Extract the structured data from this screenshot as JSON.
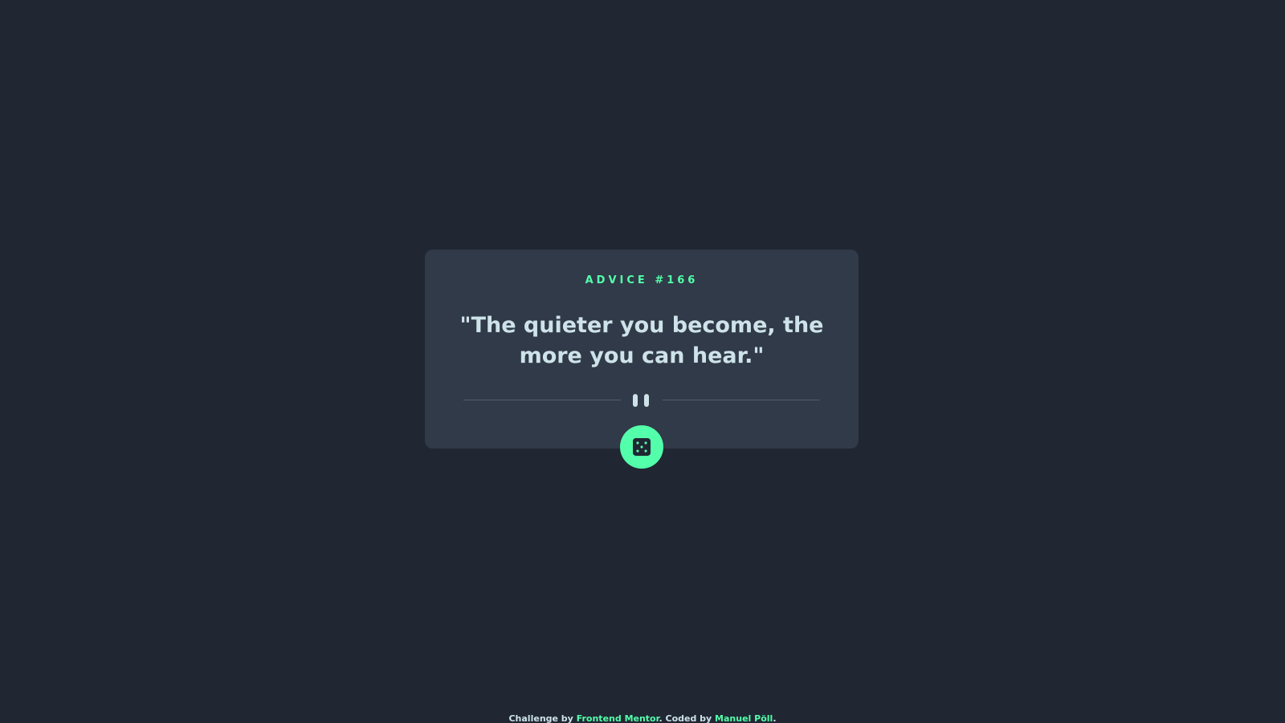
{
  "card": {
    "advice_label": "ADVICE #166",
    "quote": "\"The quieter you become, the more you can hear.\""
  },
  "dice_button": {
    "icon": "dice-icon"
  },
  "divider": {
    "icon": "pause-icon"
  },
  "footer": {
    "prefix": "Challenge by ",
    "challenge_link": "Frontend Mentor",
    "middle": ". Coded by ",
    "author_link": "Manuel Pöll",
    "suffix": "."
  },
  "colors": {
    "background": "#202733",
    "card": "#313a48",
    "accent": "#53ffaa",
    "text": "#cee3e9",
    "divider": "#4f5d74"
  }
}
